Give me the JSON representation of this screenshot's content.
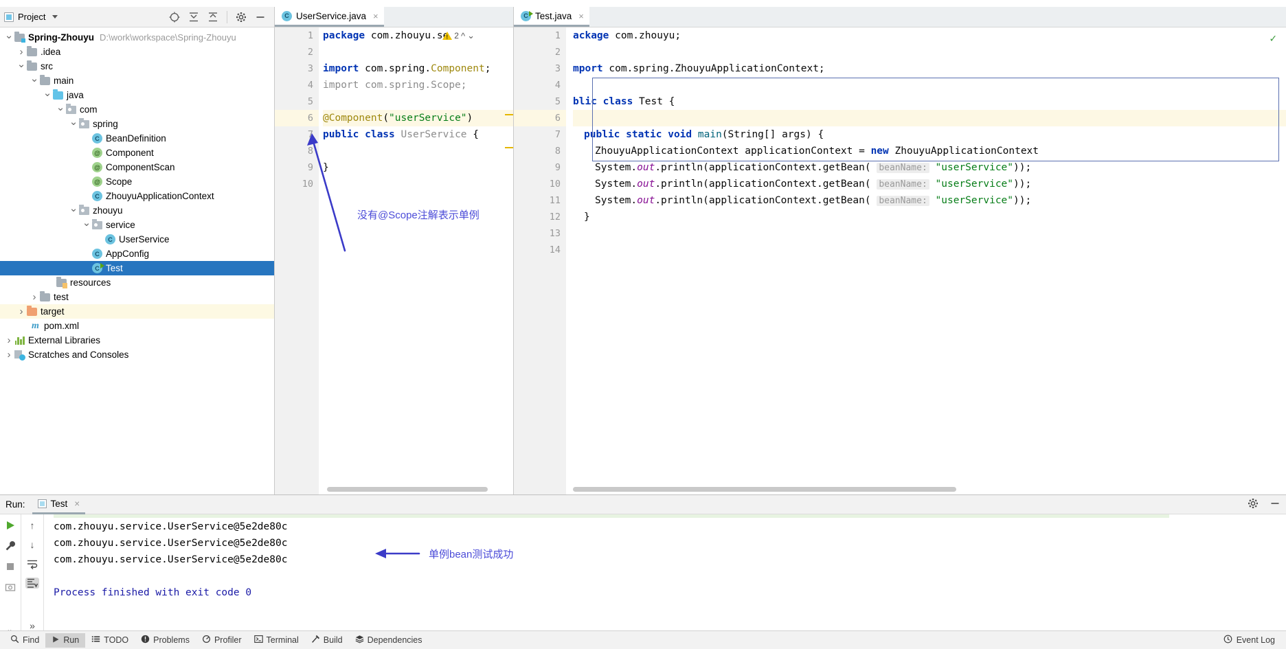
{
  "sidebar": {
    "title": "Project",
    "icons": [
      "locate-icon",
      "collapse-all-icon",
      "expand-all-icon",
      "settings-icon",
      "minimize-icon"
    ],
    "tree": [
      {
        "label": "Spring-Zhouyu",
        "path": "D:\\work\\workspace\\Spring-Zhouyu",
        "icon": "module-folder-icon",
        "depth": 0,
        "arrow": "down",
        "bold": true
      },
      {
        "label": ".idea",
        "icon": "folder-icon",
        "depth": 1,
        "arrow": "right"
      },
      {
        "label": "src",
        "icon": "folder-icon",
        "depth": 1,
        "arrow": "down"
      },
      {
        "label": "main",
        "icon": "folder-icon",
        "depth": 2,
        "arrow": "down"
      },
      {
        "label": "java",
        "icon": "source-folder-icon",
        "depth": 3,
        "arrow": "down"
      },
      {
        "label": "com",
        "icon": "package-icon",
        "depth": 4,
        "arrow": "down"
      },
      {
        "label": "spring",
        "icon": "package-icon",
        "depth": 5,
        "arrow": "down"
      },
      {
        "label": "BeanDefinition",
        "icon": "java-class-icon",
        "depth": 6
      },
      {
        "label": "Component",
        "icon": "annotation-icon",
        "depth": 6
      },
      {
        "label": "ComponentScan",
        "icon": "annotation-icon",
        "depth": 6
      },
      {
        "label": "Scope",
        "icon": "annotation-icon",
        "depth": 6
      },
      {
        "label": "ZhouyuApplicationContext",
        "icon": "java-class-icon",
        "depth": 6
      },
      {
        "label": "zhouyu",
        "icon": "package-icon",
        "depth": 5,
        "arrow": "down"
      },
      {
        "label": "service",
        "icon": "package-icon",
        "depth": 6,
        "arrow": "down"
      },
      {
        "label": "UserService",
        "icon": "java-class-icon",
        "depth": 7
      },
      {
        "label": "AppConfig",
        "icon": "java-class-icon",
        "depth": 6
      },
      {
        "label": "Test",
        "icon": "java-runnable-class-icon",
        "depth": 6,
        "selected": true
      },
      {
        "label": "resources",
        "icon": "resources-folder-icon",
        "depth": 4
      },
      {
        "label": "test",
        "icon": "folder-icon",
        "depth": 2,
        "arrow": "right"
      },
      {
        "label": "target",
        "icon": "target-folder-icon",
        "depth": 1,
        "arrow": "right",
        "highlighted": true
      },
      {
        "label": "pom.xml",
        "icon": "maven-icon",
        "depth": 2
      },
      {
        "label": "External Libraries",
        "icon": "libraries-icon",
        "depth": 0,
        "arrow": "right"
      },
      {
        "label": "Scratches and Consoles",
        "icon": "scratches-icon",
        "depth": 0,
        "arrow": "right"
      }
    ]
  },
  "editor_left": {
    "tab": {
      "label": "UserService.java",
      "icon": "java-class-icon",
      "close": "×"
    },
    "warning_count": "2",
    "warning_icon": "warning-triangle-icon",
    "line_numbers": [
      "1",
      "2",
      "3",
      "4",
      "5",
      "6",
      "7",
      "8",
      "9",
      "10"
    ],
    "lines": [
      {
        "n": 1,
        "tokens": [
          {
            "t": "package ",
            "c": "kw"
          },
          {
            "t": "com.zhouyu.se",
            "c": "plain"
          }
        ]
      },
      {
        "n": 2,
        "tokens": []
      },
      {
        "n": 3,
        "tokens": [
          {
            "t": "import ",
            "c": "kw"
          },
          {
            "t": "com.spring.",
            "c": "plain"
          },
          {
            "t": "Component",
            "c": "ann-c"
          },
          {
            "t": ";",
            "c": "plain"
          }
        ],
        "fold": "minus"
      },
      {
        "n": 4,
        "tokens": [
          {
            "t": "import ",
            "c": "gray"
          },
          {
            "t": "com.spring.Scope;",
            "c": "gray"
          }
        ],
        "fold": "tri"
      },
      {
        "n": 5,
        "tokens": []
      },
      {
        "n": 6,
        "tokens": [
          {
            "t": "@Component",
            "c": "ann-c"
          },
          {
            "t": "(",
            "c": "plain"
          },
          {
            "t": "\"userService\"",
            "c": "str"
          },
          {
            "t": ")",
            "c": "plain"
          }
        ],
        "highlight": true
      },
      {
        "n": 7,
        "tokens": [
          {
            "t": "public ",
            "c": "kw"
          },
          {
            "t": "class ",
            "c": "kw"
          },
          {
            "t": "UserService ",
            "c": "gray"
          },
          {
            "t": "{",
            "c": "plain"
          }
        ]
      },
      {
        "n": 8,
        "tokens": []
      },
      {
        "n": 9,
        "tokens": [
          {
            "t": "}",
            "c": "plain"
          }
        ]
      },
      {
        "n": 10,
        "tokens": []
      }
    ],
    "annotation": "没有@Scope注解表示单例"
  },
  "editor_right": {
    "tab": {
      "label": "Test.java",
      "icon": "java-runnable-class-icon",
      "close": "×"
    },
    "status_icon": "inspection-ok-checkmark",
    "line_numbers": [
      "1",
      "2",
      "3",
      "4",
      "5",
      "6",
      "7",
      "8",
      "9",
      "10",
      "11",
      "12",
      "13",
      "14"
    ],
    "lines": [
      {
        "n": 1,
        "text": "ackage com.zhouyu;"
      },
      {
        "n": 2,
        "text": ""
      },
      {
        "n": 3,
        "text": "mport com.spring.ZhouyuApplicationContext;"
      },
      {
        "n": 4,
        "text": ""
      },
      {
        "n": 5,
        "text": "blic class Test {",
        "run_marker": true
      },
      {
        "n": 6,
        "text": "",
        "highlight": true
      },
      {
        "n": 7,
        "text": "public static void main(String[] args) {",
        "run_marker": true,
        "fold": "minus"
      },
      {
        "n": 8,
        "text": "ZhouyuApplicationContext applicationContext = new ZhouyuApplicationContext"
      },
      {
        "n": 9,
        "text": "System.out.println(applicationContext.getBean( beanName: \"userService\"));"
      },
      {
        "n": 10,
        "text": "System.out.println(applicationContext.getBean( beanName: \"userService\"));"
      },
      {
        "n": 11,
        "text": "System.out.println(applicationContext.getBean( beanName: \"userService\"));"
      },
      {
        "n": 12,
        "text": "}",
        "fold": "tri"
      },
      {
        "n": 13,
        "text": ""
      },
      {
        "n": 14,
        "text": ""
      }
    ],
    "hint_label": "beanName:",
    "bean_name": "\"userService\""
  },
  "run_panel": {
    "label": "Run:",
    "tab": "Test",
    "tab_close": "×",
    "header_icons": [
      "settings-icon",
      "minimize-icon"
    ],
    "left_icons": [
      "rerun-play-icon",
      "wrench-icon",
      "stop-icon",
      "camera-icon",
      "expand-more-icon"
    ],
    "second_icons": [
      "up-arrow-icon",
      "down-arrow-icon",
      "soft-wrap-icon",
      "scroll-to-end-icon",
      "expand-more-icon"
    ],
    "console_lines": [
      {
        "text": "com.zhouyu.service.UserService@5e2de80c",
        "color": "black"
      },
      {
        "text": "com.zhouyu.service.UserService@5e2de80c",
        "color": "black"
      },
      {
        "text": "com.zhouyu.service.UserService@5e2de80c",
        "color": "black"
      },
      {
        "text": "",
        "color": "black"
      },
      {
        "text": "Process finished with exit code 0",
        "color": "blue"
      }
    ],
    "annotation": "单例bean测试成功"
  },
  "statusbar": {
    "items": [
      {
        "label": "Find",
        "icon": "search-icon"
      },
      {
        "label": "Run",
        "icon": "play-icon",
        "active": true
      },
      {
        "label": "TODO",
        "icon": "list-icon"
      },
      {
        "label": "Problems",
        "icon": "exclamation-circle-icon"
      },
      {
        "label": "Profiler",
        "icon": "profiler-icon"
      },
      {
        "label": "Terminal",
        "icon": "terminal-icon"
      },
      {
        "label": "Build",
        "icon": "hammer-icon"
      },
      {
        "label": "Dependencies",
        "icon": "layers-icon"
      }
    ],
    "right": {
      "label": "Event Log",
      "icon": "event-log-icon"
    }
  },
  "colors": {
    "selection": "#2675bf",
    "annotation": "#4b4bd8",
    "keyword": "#0033b3",
    "string": "#067d17",
    "annotation_token": "#9e880d",
    "line_highlight": "#fdf8e4"
  }
}
